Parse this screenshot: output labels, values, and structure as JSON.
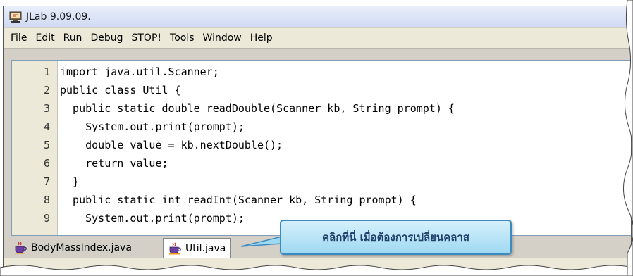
{
  "window": {
    "title": "JLab 9.09.09.",
    "app_icon": "jlab-app-icon"
  },
  "menu": [
    {
      "pre": "",
      "u": "F",
      "post": "ile"
    },
    {
      "pre": "",
      "u": "E",
      "post": "dit"
    },
    {
      "pre": "",
      "u": "R",
      "post": "un"
    },
    {
      "pre": "",
      "u": "D",
      "post": "ebug"
    },
    {
      "pre": "",
      "u": "S",
      "post": "TOP!"
    },
    {
      "pre": "",
      "u": "T",
      "post": "ools"
    },
    {
      "pre": "",
      "u": "W",
      "post": "indow"
    },
    {
      "pre": "",
      "u": "H",
      "post": "elp"
    }
  ],
  "editor": {
    "lines": [
      {
        "num": "1",
        "code": "import java.util.Scanner;"
      },
      {
        "num": "2",
        "code": "public class Util {"
      },
      {
        "num": "3",
        "code": "  public static double readDouble(Scanner kb, String prompt) {"
      },
      {
        "num": "4",
        "code": "    System.out.print(prompt);"
      },
      {
        "num": "5",
        "code": "    double value = kb.nextDouble();"
      },
      {
        "num": "6",
        "code": "    return value;"
      },
      {
        "num": "7",
        "code": "  }"
      },
      {
        "num": "8",
        "code": "  public static int readInt(Scanner kb, String prompt) {"
      },
      {
        "num": "9",
        "code": "    System.out.print(prompt);"
      }
    ]
  },
  "tabs": [
    {
      "label": "BodyMassIndex.java",
      "icon": "java-cup-icon",
      "active": false
    },
    {
      "label": "Util.java",
      "icon": "java-cup-icon",
      "active": true
    }
  ],
  "callout": {
    "text": "คลิกที่นี่ เมื่อต้องการเปลี่ยนคลาส"
  },
  "colors": {
    "callout_border": "#3c8bc0",
    "callout_fill": "#9ed9f2",
    "callout_text": "#1f3f6a"
  }
}
